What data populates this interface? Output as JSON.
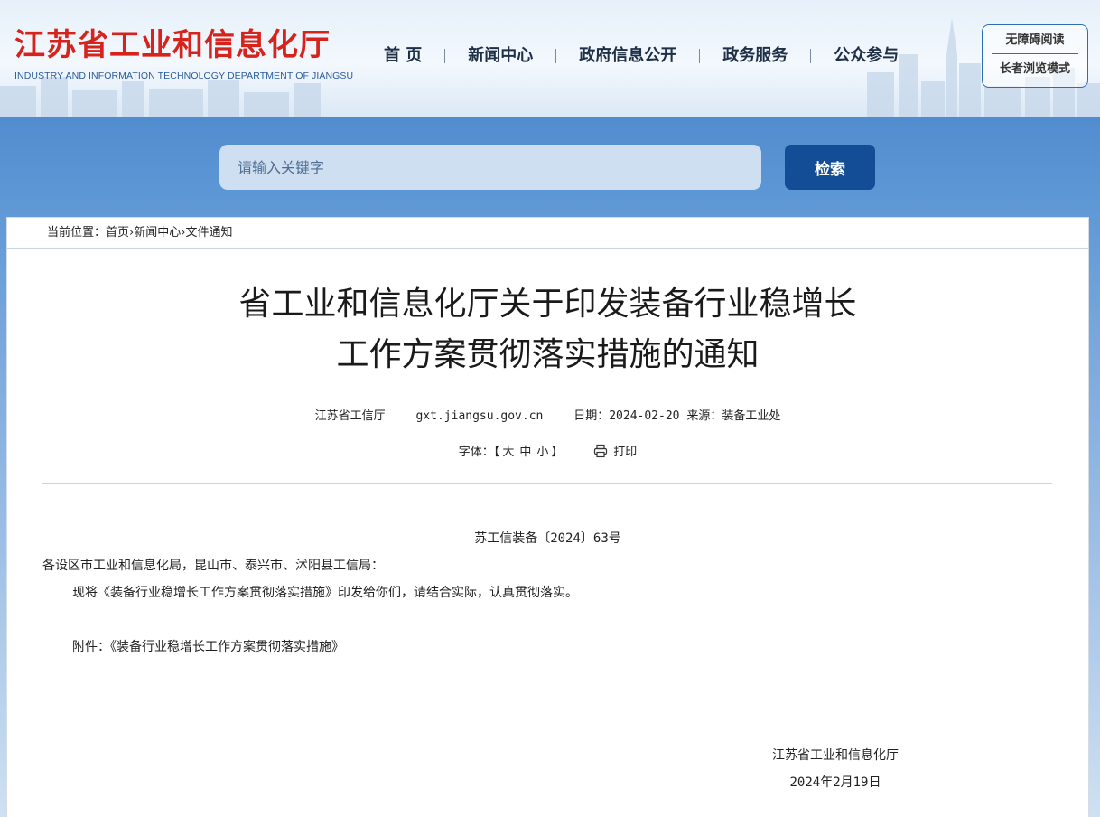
{
  "header": {
    "logo_cn": "江苏省工业和信息化厅",
    "logo_en": "INDUSTRY AND INFORMATION TECHNOLOGY DEPARTMENT OF JIANGSU",
    "nav": [
      "首 页",
      "新闻中心",
      "政府信息公开",
      "政务服务",
      "公众参与"
    ],
    "accessibility": {
      "barrier_free": "无障碍阅读",
      "elder_mode": "长者浏览模式"
    }
  },
  "search": {
    "placeholder": "请输入关键字",
    "button": "检索"
  },
  "breadcrumb": {
    "prefix": "当前位置：",
    "items": [
      "首页",
      "新闻中心",
      "文件通知"
    ],
    "separator": "›"
  },
  "article": {
    "title_line1": "省工业和信息化厅关于印发装备行业稳增长",
    "title_line2": "工作方案贯彻落实措施的通知",
    "meta": {
      "publisher": "江苏省工信厅",
      "site": "gxt.jiangsu.gov.cn",
      "date_label": "日期：",
      "date": "2024-02-20",
      "source_label": "来源：",
      "source": "装备工业处"
    },
    "font_size": {
      "label": "字体：",
      "open": "【",
      "large": "大",
      "medium": "中",
      "small": "小",
      "close": "】"
    },
    "print_label": "打印",
    "doc_number": "苏工信装备〔2024〕63号",
    "salutation": "各设区市工业和信息化局，昆山市、泰兴市、沭阳县工信局：",
    "paragraph1": "现将《装备行业稳增长工作方案贯彻落实措施》印发给你们，请结合实际，认真贯彻落实。",
    "attachment": "附件：《装备行业稳增长工作方案贯彻落实措施》",
    "signature_org": "江苏省工业和信息化厅",
    "signature_date": "2024年2月19日"
  },
  "colors": {
    "logo_red": "#d6231c",
    "nav_text": "#1f2f46",
    "search_button": "#124d96",
    "search_input_bg": "#cfdff2",
    "band_blue": "#3f7cc4"
  },
  "icons": {
    "print": "printer-icon",
    "skyline": "city-skyline-decoration"
  }
}
